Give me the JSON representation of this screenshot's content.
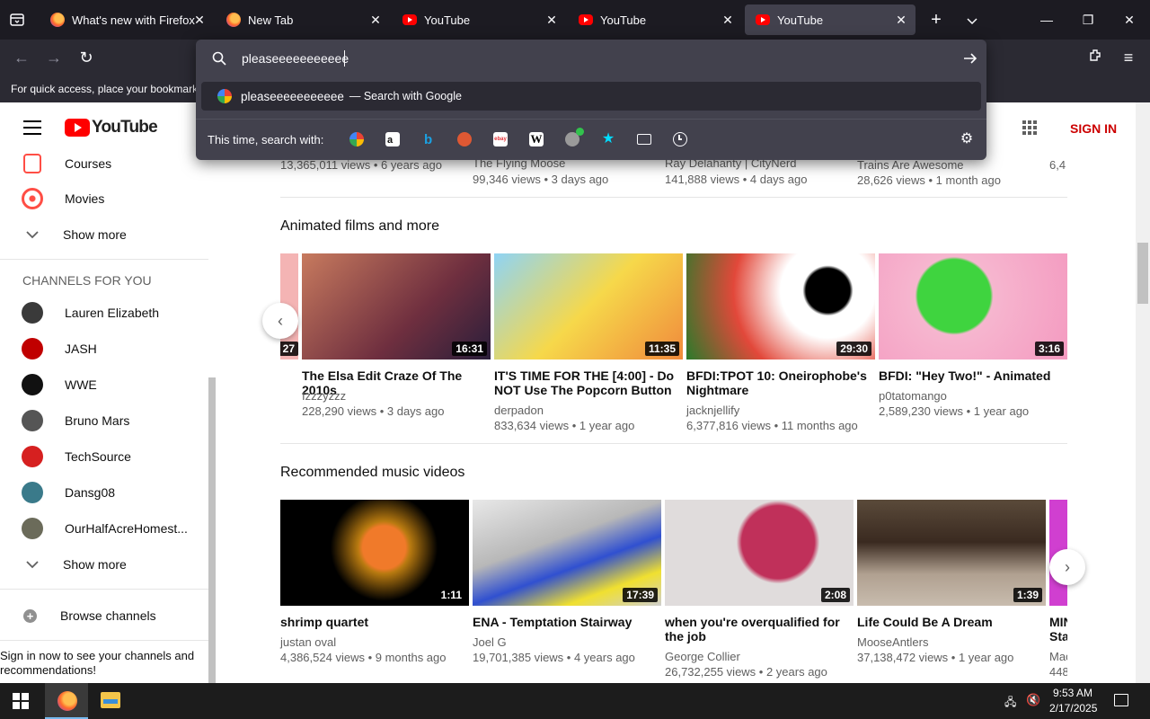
{
  "browser": {
    "tabs": [
      {
        "title": "What's new with Firefox",
        "icon": "firefox-icon",
        "active": false
      },
      {
        "title": "New Tab",
        "icon": "firefox-icon",
        "active": false
      },
      {
        "title": "YouTube",
        "icon": "youtube-icon",
        "active": false
      },
      {
        "title": "YouTube",
        "icon": "youtube-icon",
        "active": false
      },
      {
        "title": "YouTube",
        "icon": "youtube-icon",
        "active": true
      }
    ],
    "bookmark_hint": "For quick access, place your bookmarks",
    "url_value": "pleaseeeeeeeeeee",
    "suggestion": {
      "query": "pleaseeeeeeeeeee",
      "suffix": "— Search with Google"
    },
    "search_with_label": "This time, search with:",
    "engines": [
      "google-icon",
      "amazon-icon",
      "bing-icon",
      "duckduckgo-icon",
      "ebay-icon",
      "wikipedia-icon",
      "extension-search-icon",
      "bookmarks-icon",
      "tabs-icon",
      "history-icon"
    ]
  },
  "youtube": {
    "logo": "YouTube",
    "sign_in": "SIGN IN",
    "sidebar": {
      "top_items": [
        {
          "label": "Courses",
          "icon": "courses-icon"
        },
        {
          "label": "Movies",
          "icon": "movies-icon"
        }
      ],
      "show_more_1": "Show more",
      "channels_title": "CHANNELS FOR YOU",
      "channels": [
        {
          "name": "Lauren Elizabeth",
          "color": "#3a3a3a"
        },
        {
          "name": "JASH",
          "color": "#c00000"
        },
        {
          "name": "WWE",
          "color": "#111111"
        },
        {
          "name": "Bruno Mars",
          "color": "#555555"
        },
        {
          "name": "TechSource",
          "color": "#d62020"
        },
        {
          "name": "Dansg08",
          "color": "#3a7a8a"
        },
        {
          "name": "OurHalfAcreHomest...",
          "color": "#6b6b5a"
        }
      ],
      "show_more_2": "Show more",
      "browse_channels": "Browse channels",
      "signin_prompt": "Sign in now to see your channels and recommendations!"
    },
    "top_row": [
      {
        "meta": "13,365,011 views  •  6 years ago"
      },
      {
        "channel": "The Flying Moose",
        "meta": "99,346 views  •  3 days ago"
      },
      {
        "channel": "Ray Delahanty | CityNerd",
        "meta": "141,888 views  •  4 days ago"
      },
      {
        "channel": "Trains Are Awesome",
        "meta": "28,626 views  •  1 month ago"
      },
      {
        "channel": "6,4"
      }
    ],
    "section1": {
      "title": "Animated films and more",
      "prev_duration": "27",
      "videos": [
        {
          "title": "The Elsa Edit Craze Of The 2010s",
          "channel": "Izzzyzzz",
          "meta": "228,290 views  •  3 days ago",
          "duration": "16:31",
          "bg": "#b35a4a"
        },
        {
          "title": "IT'S TIME FOR THE [4:00] - Do NOT Use The Popcorn Button",
          "channel": "derpadon",
          "meta": "833,634 views  •  1 year ago",
          "duration": "11:35",
          "bg": "#f2d24c"
        },
        {
          "title": "BFDI:TPOT 10: Oneirophobe's Nightmare",
          "channel": "jacknjellify",
          "meta": "6,377,816 views  •  11 months ago",
          "duration": "29:30",
          "bg": "#e2483a"
        },
        {
          "title": "BFDI: \"Hey Two!\" - Animated",
          "channel": "p0tatomango",
          "meta": "2,589,230 views  •  1 year ago",
          "duration": "3:16",
          "bg": "#f4a7c8"
        }
      ]
    },
    "section2": {
      "title": "Recommended music videos",
      "videos": [
        {
          "title": "shrimp quartet",
          "channel": "justan oval",
          "meta": "4,386,524 views  •  9 months ago",
          "duration": "1:11",
          "bg": "#0a0a0a"
        },
        {
          "title": "ENA - Temptation Stairway",
          "channel": "Joel G",
          "meta": "19,701,385 views  •  4 years ago",
          "duration": "17:39",
          "bg": "#cfcfcf"
        },
        {
          "title": "when you're overqualified for the job",
          "channel": "George Collier",
          "meta": "26,732,255 views  •  2 years ago",
          "duration": "2:08",
          "bg": "#d9d4d4"
        },
        {
          "title": "Life Could Be A Dream",
          "channel": "MooseAntlers",
          "meta": "37,138,472 views  •  1 year ago",
          "duration": "1:39",
          "bg": "#9a8a7a"
        },
        {
          "title": "MIN\nSta",
          "channel": "Mac",
          "meta": "448",
          "bg": "#d03fd0"
        }
      ]
    }
  },
  "taskbar": {
    "time": "9:53 AM",
    "date": "2/17/2025"
  }
}
